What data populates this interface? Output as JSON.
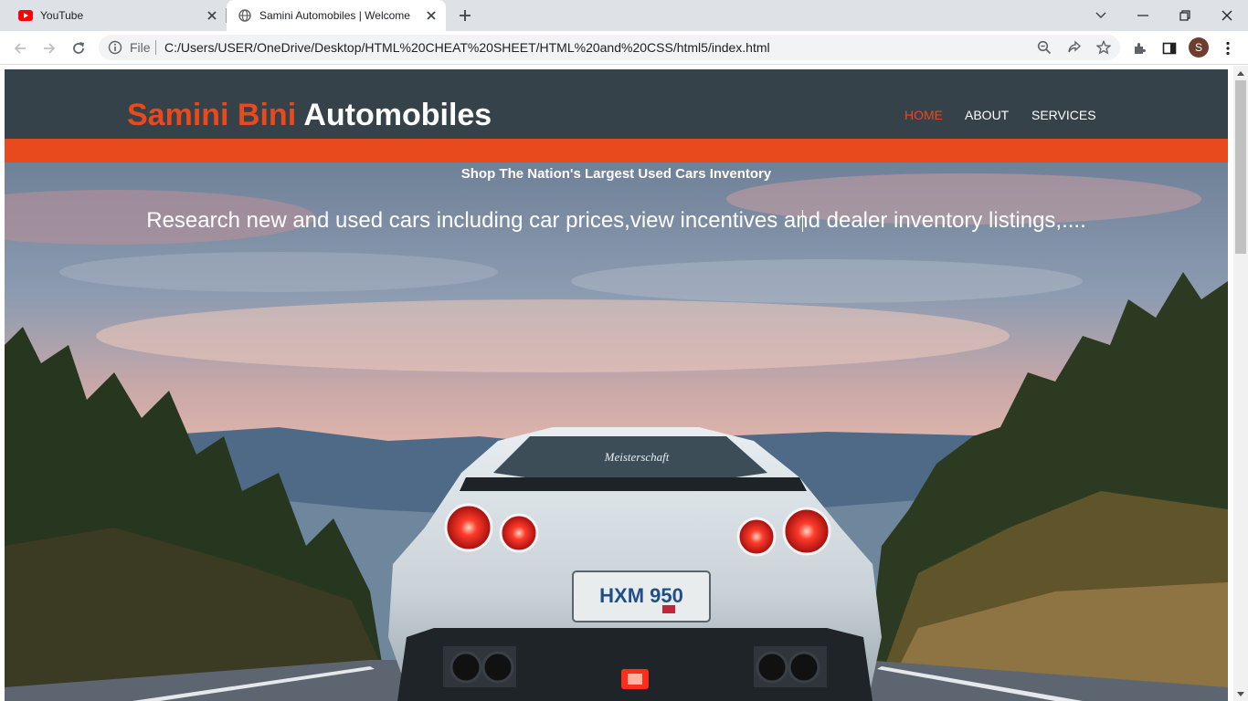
{
  "browser": {
    "tabs": [
      {
        "title": "YouTube",
        "icon": "youtube-icon",
        "active": false
      },
      {
        "title": "Samini Automobiles | Welcome",
        "icon": "globe-icon",
        "active": true
      }
    ],
    "address": {
      "scheme_label": "File",
      "url": "C:/Users/USER/OneDrive/Desktop/HTML%20CHEAT%20SHEET/HTML%20and%20CSS/html5/index.html"
    },
    "profile_initial": "S",
    "colors": {
      "tabstrip": "#dee1e6",
      "toolbar": "#ffffff",
      "omnibox": "#f1f3f4",
      "avatar": "#6d3e2e"
    }
  },
  "site": {
    "brand_highlight": "Samini Bini",
    "brand_rest": "Automobiles",
    "nav": [
      {
        "label": "HOME",
        "active": true
      },
      {
        "label": "ABOUT",
        "active": false
      },
      {
        "label": "SERVICES",
        "active": false
      }
    ],
    "hero": {
      "tagline": "Shop The Nation's Largest Used Cars Inventory",
      "description": "Research new and used cars including car prices,view incentives and dealer inventory listings,....",
      "plate": "HXM 950",
      "rear_text": "Meisterschaft"
    },
    "colors": {
      "header_bg": "#35424a",
      "accent": "#e8491d",
      "text": "#ffffff"
    }
  }
}
